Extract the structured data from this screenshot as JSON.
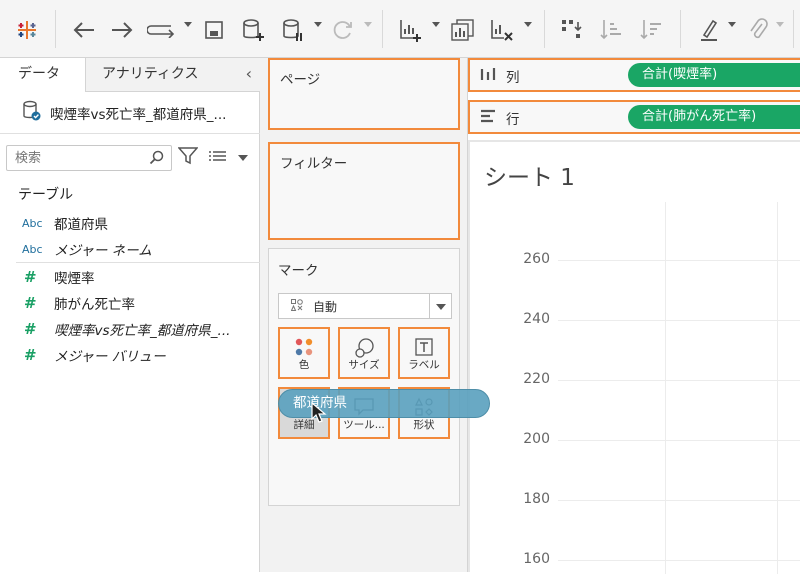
{
  "left_panel": {
    "tabs": {
      "data": "データ",
      "analytics": "アナリティクス"
    },
    "datasource": "喫煙率vs死亡率_都道府県_...",
    "search": {
      "placeholder": "検索"
    },
    "section_title": "テーブル",
    "fields": [
      {
        "type": "Abc",
        "name": "都道府県"
      },
      {
        "type": "Abc",
        "name": "メジャー ネーム"
      },
      {
        "type": "#",
        "name": "喫煙率"
      },
      {
        "type": "#",
        "name": "肺がん死亡率"
      },
      {
        "type": "#",
        "name": "喫煙率vs死亡率_都道府県_..."
      },
      {
        "type": "#",
        "name": "メジャー バリュー"
      }
    ]
  },
  "cards": {
    "pages": "ページ",
    "filters": "フィルター",
    "marks": {
      "title": "マーク",
      "type": "自動",
      "buttons": {
        "color": "色",
        "size": "サイズ",
        "label": "ラベル",
        "detail": "詳細",
        "tooltip": "ツール...",
        "shape": "形状"
      }
    }
  },
  "shelves": {
    "columns": {
      "label": "列",
      "pill": "合計(喫煙率)"
    },
    "rows": {
      "label": "行",
      "pill": "合計(肺がん死亡率)"
    }
  },
  "sheet": {
    "title": "シート 1",
    "y_ticks": [
      "260",
      "240",
      "220",
      "200",
      "180",
      "160"
    ]
  },
  "drag": {
    "label": "都道府県"
  },
  "colors": {
    "accent_orange": "#f28a3c",
    "pill_green": "#1aa665",
    "drag_blue": "#59a0be"
  }
}
